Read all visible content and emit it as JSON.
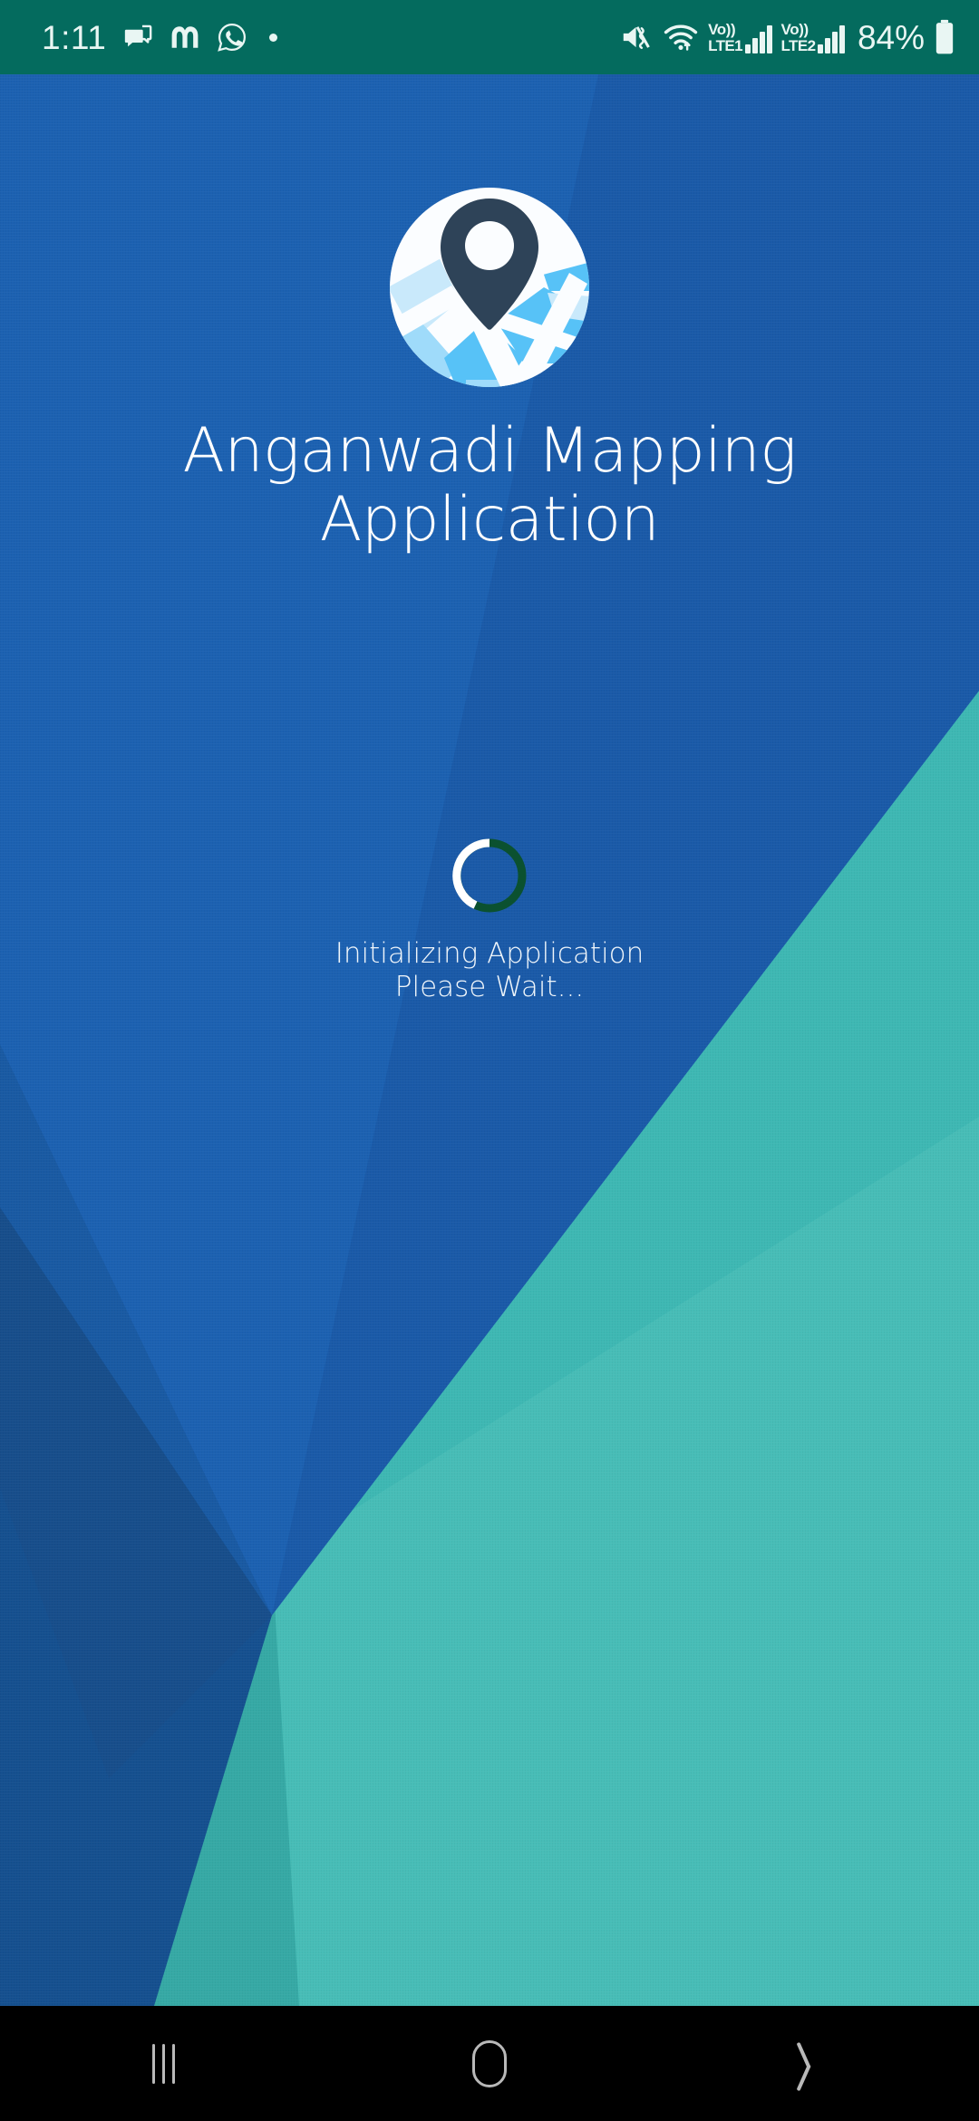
{
  "status_bar": {
    "background_color": "#046B5E",
    "time": "1:11",
    "icons": [
      {
        "name": "messages-icon"
      },
      {
        "name": "m-app-icon"
      },
      {
        "name": "whatsapp-icon"
      },
      {
        "name": "notification-dot-icon"
      }
    ],
    "mute_icon": "volume-mute-vibrate-icon",
    "wifi_icon": "wifi-icon",
    "sim1": {
      "volte_label_top": "Vo))",
      "volte_label_bottom": "LTE1",
      "signal_icon": "signal-bars-icon",
      "bars": 4
    },
    "sim2": {
      "volte_label_top": "Vo))",
      "volte_label_bottom": "LTE2",
      "signal_icon": "signal-bars-icon",
      "bars": 4
    },
    "battery_percent": "84%",
    "battery_icon": "battery-icon"
  },
  "splash": {
    "logo_icon": "map-location-pin-logo",
    "app_title": "Anganwadi Mapping Application",
    "spinner_icon": "loading-spinner-icon",
    "spinner_colors": {
      "track": "#0B5130",
      "progress": "#FFFFFF"
    },
    "loading_line1": "Initializing Application",
    "loading_line2": "Please Wait..."
  },
  "background": {
    "blue_primary": "#1C5FAE",
    "blue_mid": "#1A57A3",
    "blue_shadow": "#17518F",
    "blue_deep": "#164E92",
    "teal_primary": "#3EB8B3",
    "teal_light": "#4FC3BD",
    "teal_shadow": "#35A8A4"
  },
  "nav_bar": {
    "background_color": "#000000",
    "buttons": [
      {
        "name": "recents-button",
        "icon": "recents-icon"
      },
      {
        "name": "home-button",
        "icon": "home-icon"
      },
      {
        "name": "back-button",
        "icon": "back-chevron-icon"
      }
    ]
  }
}
